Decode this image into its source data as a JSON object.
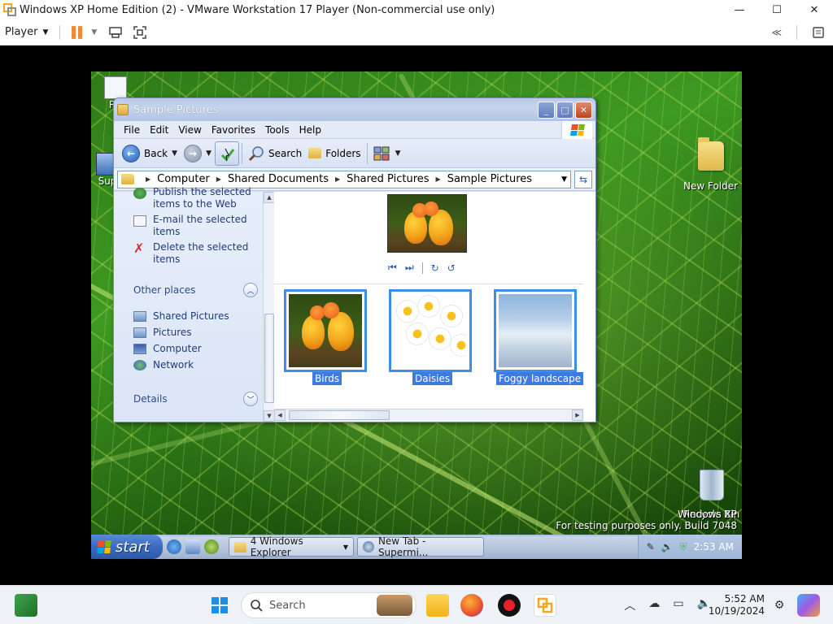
{
  "vmware": {
    "title": "Windows XP Home Edition (2) - VMware Workstation 17 Player (Non-commercial use only)",
    "player_menu": "Player",
    "controls": {
      "minimize": "—",
      "maximize": "☐",
      "close": "✕"
    }
  },
  "desktop": {
    "icons": [
      {
        "label": "New Folder"
      },
      {
        "label": "Recycle Bin"
      }
    ],
    "partial_labels": [
      "R",
      "Sup"
    ],
    "watermark": {
      "line1": "Windows XP",
      "line2": "For testing purposes only. Build 7048"
    }
  },
  "explorer": {
    "title": "Sample Pictures",
    "menu": [
      "File",
      "Edit",
      "View",
      "Favorites",
      "Tools",
      "Help"
    ],
    "toolbar": {
      "back": "Back",
      "search": "Search",
      "folders": "Folders"
    },
    "address": {
      "crumbs": [
        "Computer",
        "Shared Documents",
        "Shared Pictures",
        "Sample Pictures"
      ]
    },
    "tasks": [
      {
        "label": "Publish the selected items to the Web",
        "icon": "globe-icon"
      },
      {
        "label": "E-mail the selected items",
        "icon": "email-icon"
      },
      {
        "label": "Delete the selected items",
        "icon": "delete-x-icon"
      }
    ],
    "other_places": {
      "heading": "Other places",
      "items": [
        "Shared Pictures",
        "Pictures",
        "Computer",
        "Network"
      ]
    },
    "details": {
      "heading": "Details"
    },
    "thumbnails": [
      {
        "label": "Birds"
      },
      {
        "label": "Daisies"
      },
      {
        "label": "Foggy landscape"
      }
    ]
  },
  "xp_taskbar": {
    "start": "start",
    "buttons": [
      "4 Windows Explorer",
      "New Tab - Supermi..."
    ],
    "clock": "2:53 AM"
  },
  "host_taskbar": {
    "search_placeholder": "Search",
    "time": "5:52 AM",
    "date": "10/19/2024"
  },
  "colors": {
    "xp_selection": "#3d7be0",
    "vm_pause": "#f08a3a"
  }
}
